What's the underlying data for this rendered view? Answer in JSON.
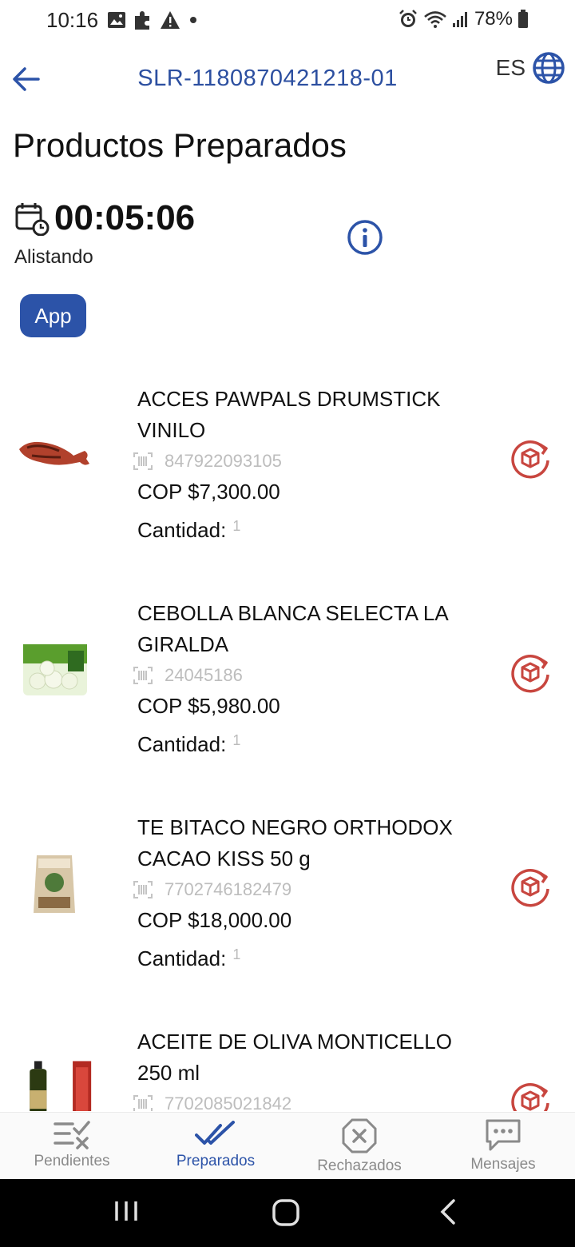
{
  "status_bar": {
    "time": "10:16",
    "battery": "78%"
  },
  "header": {
    "order_id": "SLR-1180870421218-01",
    "language": "ES"
  },
  "page": {
    "title": "Productos Preparados"
  },
  "timer": {
    "value": "00:05:06",
    "status": "Alistando"
  },
  "badge": {
    "label": "App"
  },
  "quantity_label": "Cantidad:",
  "products": [
    {
      "name": "ACCES PAWPALS DRUMSTICK VINILO",
      "barcode": "847922093105",
      "price": "COP $7,300.00",
      "quantity": "1"
    },
    {
      "name": "CEBOLLA BLANCA SELECTA LA GIRALDA",
      "barcode": "24045186",
      "price": "COP $5,980.00",
      "quantity": "1"
    },
    {
      "name": "TE BITACO NEGRO ORTHODOX CACAO KISS 50 g",
      "barcode": "7702746182479",
      "price": "COP $18,000.00",
      "quantity": "1"
    },
    {
      "name": "ACEITE DE OLIVA MONTICELLO 250 ml",
      "barcode": "7702085021842",
      "price": "",
      "quantity": ""
    }
  ],
  "bottom_nav": [
    {
      "label": "Pendientes",
      "icon": "list-check-icon",
      "active": false
    },
    {
      "label": "Preparados",
      "icon": "double-check-icon",
      "active": true
    },
    {
      "label": "Rechazados",
      "icon": "rejected-x-icon",
      "active": false
    },
    {
      "label": "Mensajes",
      "icon": "chat-bubble-icon",
      "active": false
    }
  ],
  "colors": {
    "primary": "#2c53a8",
    "accent_red": "#c8463f",
    "muted": "#8a8a8a"
  }
}
